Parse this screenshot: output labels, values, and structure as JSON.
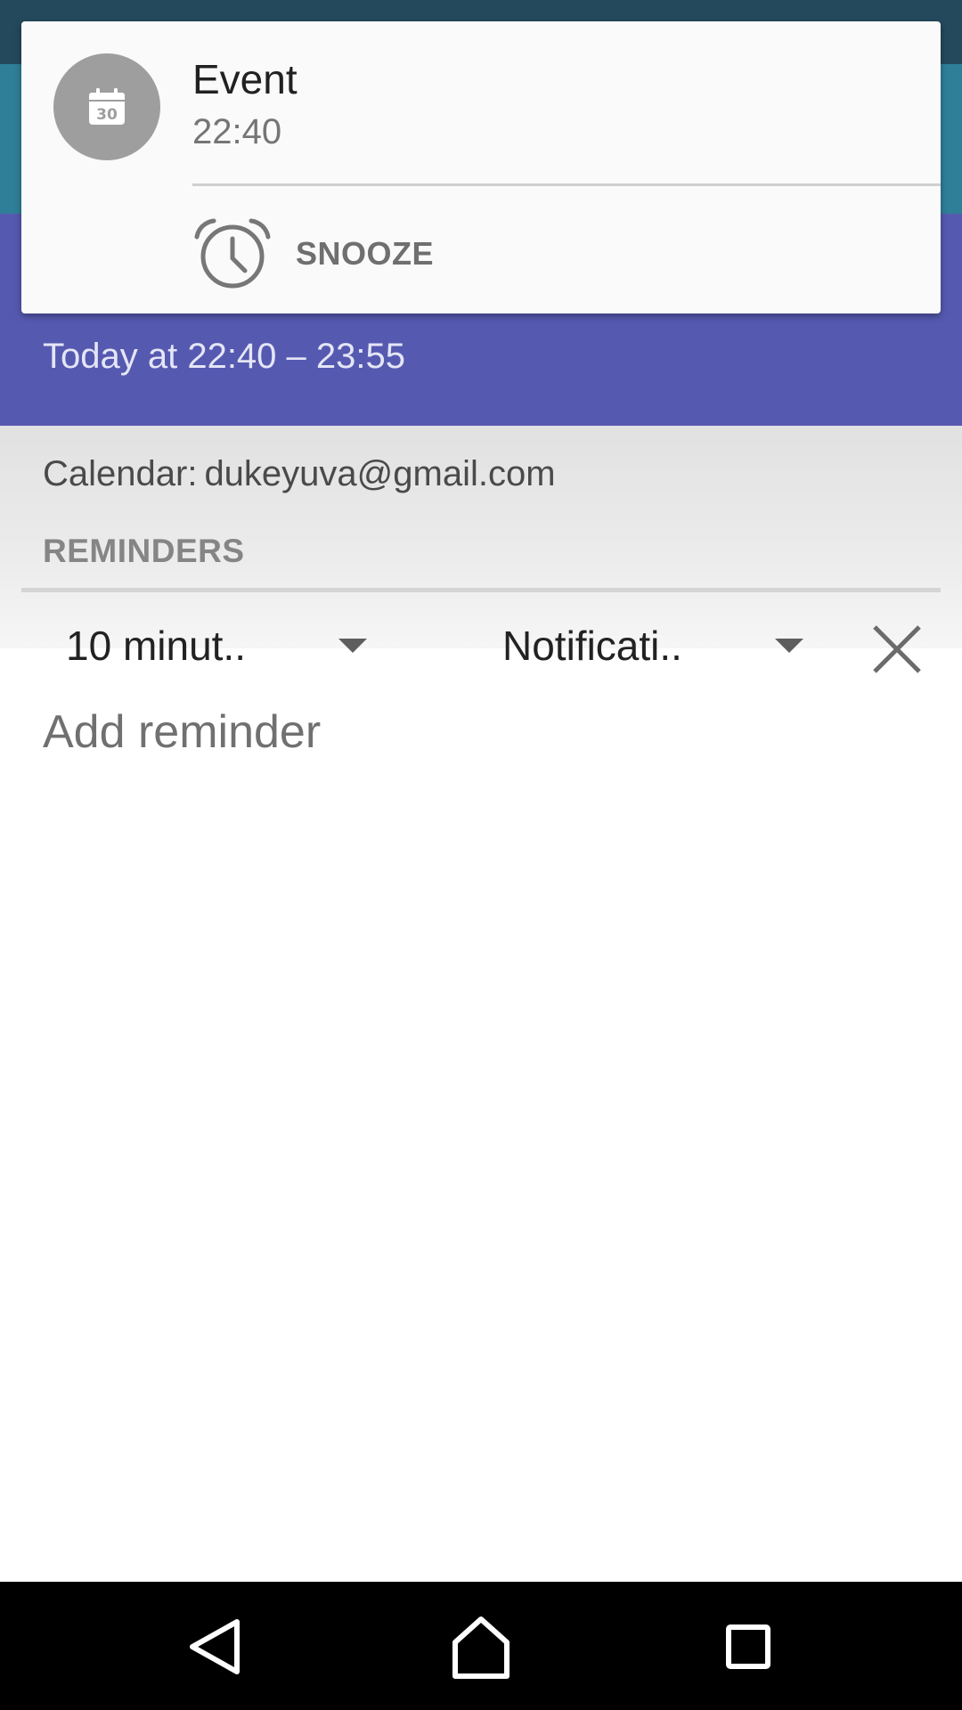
{
  "event": {
    "time_range": "Today at 22:40 – 23:55",
    "calendar_label": "Calendar:",
    "calendar_account": "dukeyuva@gmail.com"
  },
  "reminders": {
    "section_title": "REMINDERS",
    "items": [
      {
        "minutes_value": "10 minut..",
        "method_value": "Notificati.."
      }
    ],
    "add_label": "Add reminder"
  },
  "notification": {
    "title": "Event",
    "time": "22:40",
    "icon_day": "30",
    "action_label": "SNOOZE",
    "icon": "calendar-icon",
    "action_icon": "alarm-clock-icon"
  },
  "nav": {
    "icons": [
      "back-icon",
      "home-icon",
      "recents-icon"
    ]
  },
  "colors": {
    "status_bar": "#24495c",
    "toolbar": "#2f7f99",
    "event_header": "#5659b0",
    "notification_bg": "#fafafa",
    "nav_bar": "#000000"
  }
}
